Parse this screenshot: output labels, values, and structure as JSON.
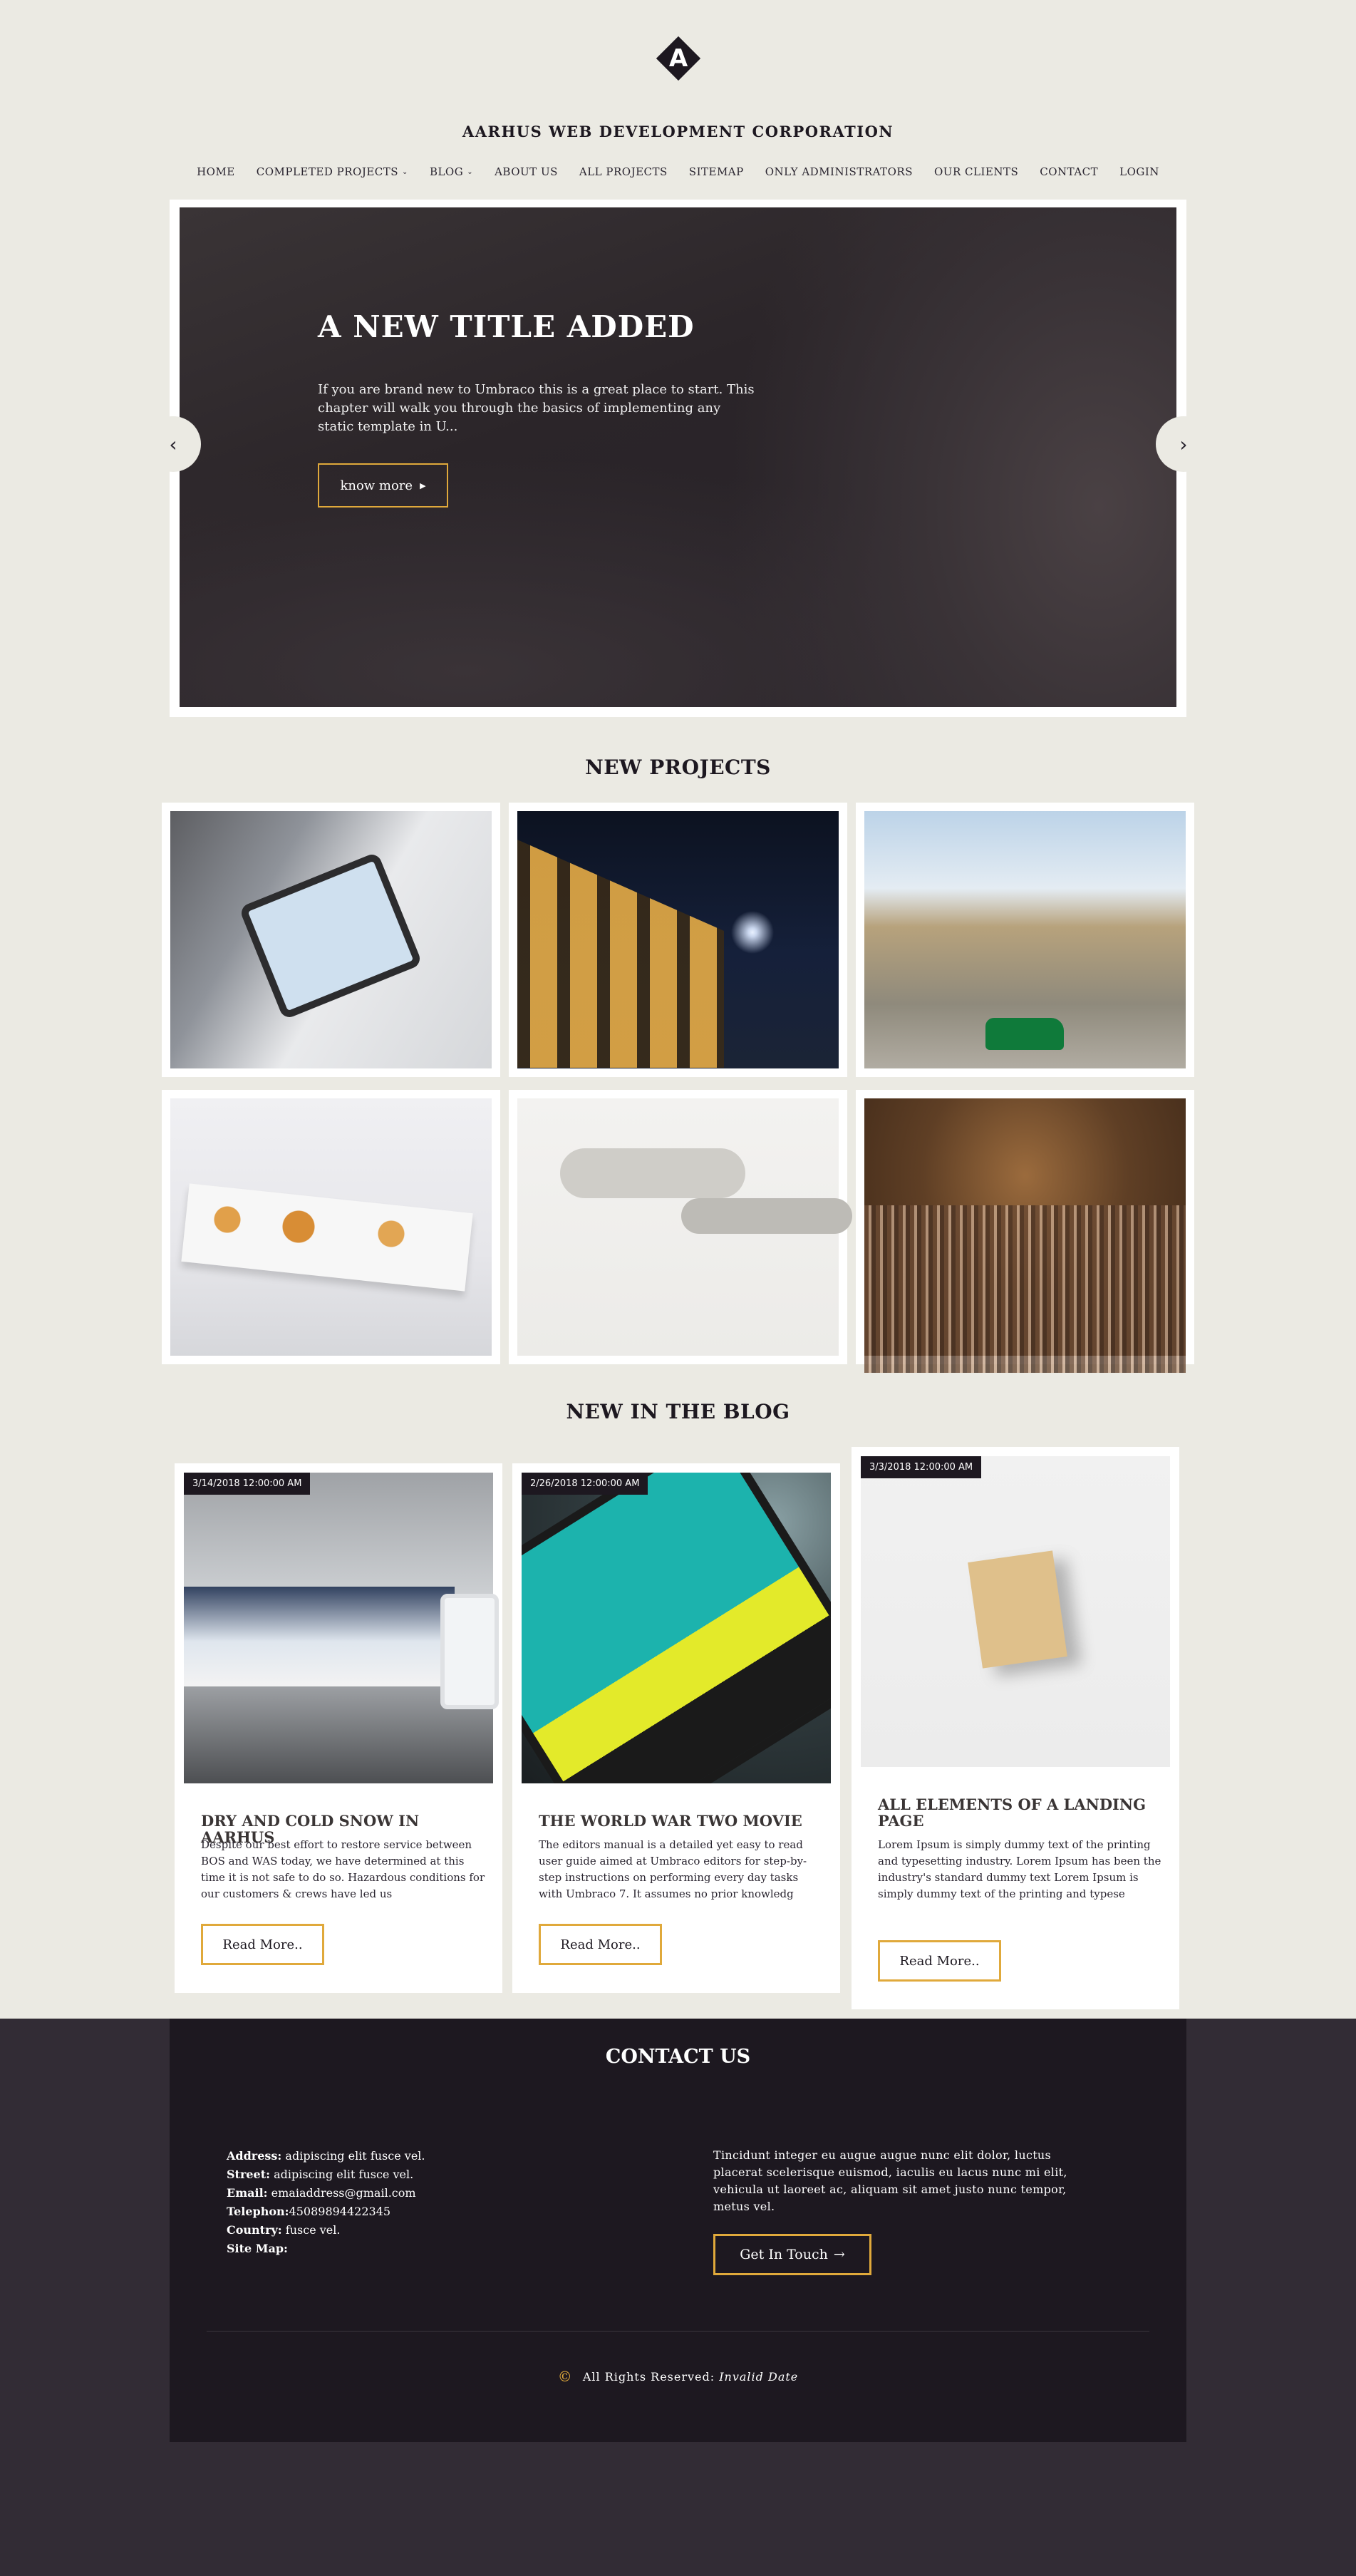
{
  "site": {
    "logo_glyph": "A",
    "title": "AARHUS WEB DEVELOPMENT CORPORATION"
  },
  "nav": [
    {
      "label": "HOME",
      "dropdown": false
    },
    {
      "label": "COMPLETED PROJECTS",
      "dropdown": true
    },
    {
      "label": "BLOG",
      "dropdown": true
    },
    {
      "label": "ABOUT US",
      "dropdown": false
    },
    {
      "label": "ALL PROJECTS",
      "dropdown": false
    },
    {
      "label": "SITEMAP",
      "dropdown": false
    },
    {
      "label": "ONLY ADMINISTRATORS",
      "dropdown": false
    },
    {
      "label": "OUR CLIENTS",
      "dropdown": false
    },
    {
      "label": "CONTACT",
      "dropdown": false
    },
    {
      "label": "LOGIN",
      "dropdown": false
    }
  ],
  "hero": {
    "title": "A NEW TITLE ADDED",
    "text": "If you are brand new to Umbraco this is a great place to start. This chapter will walk you through the basics of implementing any static template in U...",
    "button": "know more",
    "prev_icon": "chevron-left-icon",
    "next_icon": "chevron-right-icon"
  },
  "projects": {
    "title": "NEW PROJECTS",
    "items": [
      {
        "image": "tablet-coffee"
      },
      {
        "image": "colosseum-night"
      },
      {
        "image": "havana-street"
      },
      {
        "image": "plated-food"
      },
      {
        "image": "wooden-tables"
      },
      {
        "image": "concert-hall"
      }
    ]
  },
  "blog": {
    "title": "NEW IN THE BLOG",
    "posts": [
      {
        "date": "3/14/2018 12:00:00 AM",
        "title": "DRY AND COLD SNOW IN AARHUS",
        "excerpt": "Despite our best effort to restore service between BOS and WAS today, we have determined at this time it is not safe to do so. Hazardous conditions for our customers & crews have led us",
        "button": "Read More.."
      },
      {
        "date": "2/26/2018 12:00:00 AM",
        "title": "THE WORLD WAR TWO MOVIE",
        "excerpt": "The editors manual is a detailed yet easy to read user guide aimed at Umbraco editors for step-by-step instructions on performing every day tasks with Umbraco 7. It assumes no prior knowledg",
        "button": "Read More.."
      },
      {
        "date": "3/3/2018 12:00:00 AM",
        "title": "ALL ELEMENTS OF A LANDING PAGE",
        "excerpt": "Lorem Ipsum is simply dummy text of the printing and typesetting industry. Lorem Ipsum has been the industry's standard dummy text Lorem Ipsum is simply dummy text of the printing and typese",
        "button": "Read More.."
      }
    ]
  },
  "contact": {
    "title": "CONTACT US",
    "info": [
      {
        "label": "Address:",
        "value": "adipiscing elit fusce vel."
      },
      {
        "label": "Street:",
        "value": "adipiscing elit fusce vel."
      },
      {
        "label": "Email:",
        "value": "emaiaddress@gmail.com"
      },
      {
        "label": "Telephon:",
        "value": "45089894422345"
      },
      {
        "label": "Country:",
        "value": "fusce vel."
      },
      {
        "label": "Site Map:",
        "value": ""
      }
    ],
    "text": "Tincidunt integer eu augue augue nunc elit dolor, luctus placerat scelerisque euismod, iaculis eu lacus nunc mi elit, vehicula ut laoreet ac, aliquam sit amet justo nunc tempor, metus vel.",
    "button": "Get In Touch",
    "button_arrow": "→",
    "copyright_symbol": "©",
    "copyright_text": "All Rights Reserved:",
    "copyright_date": "Invalid Date"
  },
  "colors": {
    "background": "#ebeae3",
    "dark": "#1d1820",
    "accent": "#e0a93b",
    "bottom_band": "#322c35"
  }
}
